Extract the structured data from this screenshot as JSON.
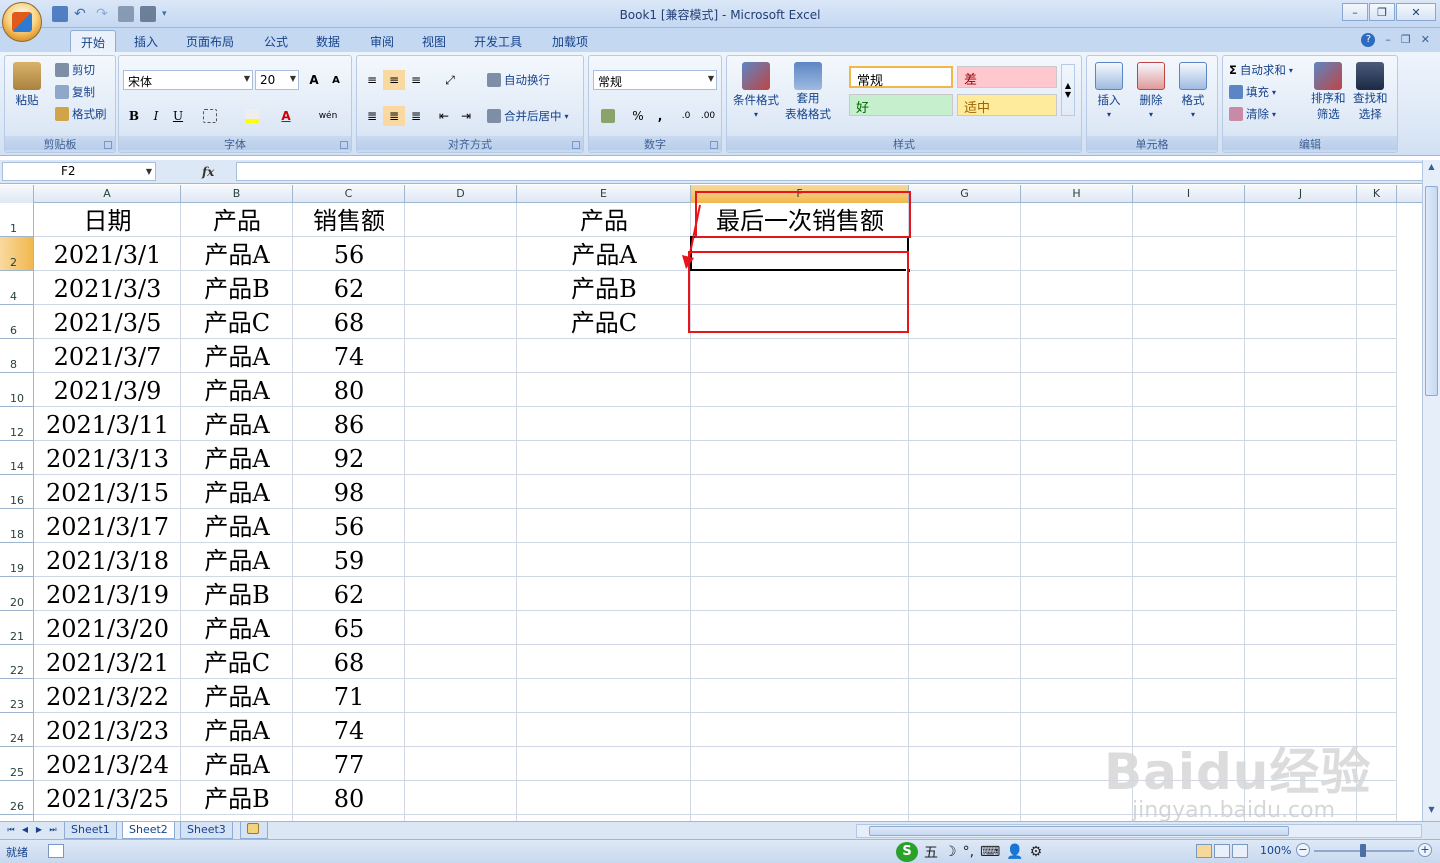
{
  "window": {
    "title": "Book1  [兼容模式] - Microsoft Excel",
    "minimize": "–",
    "restore": "❐",
    "close": "✕"
  },
  "tabs": [
    "开始",
    "插入",
    "页面布局",
    "公式",
    "数据",
    "审阅",
    "视图",
    "开发工具",
    "加载项"
  ],
  "ribbon": {
    "clipboard": {
      "paste": "粘贴",
      "cut": "剪切",
      "copy": "复制",
      "format_painter": "格式刷",
      "label": "剪贴板"
    },
    "font": {
      "name": "宋体",
      "size": "20",
      "bold": "B",
      "italic": "I",
      "underline": "U",
      "label": "字体",
      "grow": "A",
      "shrink": "A",
      "font_color": "A",
      "phonetic": "wén"
    },
    "alignment": {
      "wrap": "自动换行",
      "merge": "合并后居中",
      "label": "对齐方式"
    },
    "number": {
      "format": "常规",
      "percent": "%",
      "comma": ",",
      "label": "数字"
    },
    "styles": {
      "conditional": "条件格式",
      "table": "套用",
      "table2": "表格格式",
      "normal": "常规",
      "bad": "差",
      "good": "好",
      "neutral": "适中",
      "label": "样式"
    },
    "cells": {
      "insert": "插入",
      "delete": "删除",
      "format": "格式",
      "label": "单元格"
    },
    "editing": {
      "autosum": "自动求和",
      "fill": "填充",
      "clear": "清除",
      "sort1": "排序和",
      "sort2": "筛选",
      "find1": "查找和",
      "find2": "选择",
      "label": "编辑"
    },
    "colors": {
      "bad_bg": "#ffc7ce",
      "bad_fg": "#9c0006",
      "good_bg": "#c6efce",
      "good_fg": "#006100",
      "neutral_bg": "#ffeb9c",
      "neutral_fg": "#9c6500"
    }
  },
  "formula_bar": {
    "name_box": "F2",
    "fx": "fx",
    "value": ""
  },
  "columns": [
    "A",
    "B",
    "C",
    "D",
    "E",
    "F",
    "G",
    "H",
    "I",
    "J",
    "K"
  ],
  "selected_column": "F",
  "rows": [
    {
      "num": "1",
      "a": "日期",
      "b": "产品",
      "c": "销售额",
      "e": "产品",
      "f": "最后一次销售额"
    },
    {
      "num": "2",
      "a": "2021/3/1",
      "b": "产品A",
      "c": "56",
      "e": "产品A",
      "f": ""
    },
    {
      "num": "4",
      "a": "2021/3/3",
      "b": "产品B",
      "c": "62",
      "e": "产品B",
      "f": ""
    },
    {
      "num": "6",
      "a": "2021/3/5",
      "b": "产品C",
      "c": "68",
      "e": "产品C",
      "f": ""
    },
    {
      "num": "8",
      "a": "2021/3/7",
      "b": "产品A",
      "c": "74",
      "e": "",
      "f": ""
    },
    {
      "num": "10",
      "a": "2021/3/9",
      "b": "产品A",
      "c": "80",
      "e": "",
      "f": ""
    },
    {
      "num": "12",
      "a": "2021/3/11",
      "b": "产品A",
      "c": "86",
      "e": "",
      "f": ""
    },
    {
      "num": "14",
      "a": "2021/3/13",
      "b": "产品A",
      "c": "92",
      "e": "",
      "f": ""
    },
    {
      "num": "16",
      "a": "2021/3/15",
      "b": "产品A",
      "c": "98",
      "e": "",
      "f": ""
    },
    {
      "num": "18",
      "a": "2021/3/17",
      "b": "产品A",
      "c": "56",
      "e": "",
      "f": ""
    },
    {
      "num": "19",
      "a": "2021/3/18",
      "b": "产品A",
      "c": "59",
      "e": "",
      "f": ""
    },
    {
      "num": "20",
      "a": "2021/3/19",
      "b": "产品B",
      "c": "62",
      "e": "",
      "f": ""
    },
    {
      "num": "21",
      "a": "2021/3/20",
      "b": "产品A",
      "c": "65",
      "e": "",
      "f": ""
    },
    {
      "num": "22",
      "a": "2021/3/21",
      "b": "产品C",
      "c": "68",
      "e": "",
      "f": ""
    },
    {
      "num": "23",
      "a": "2021/3/22",
      "b": "产品A",
      "c": "71",
      "e": "",
      "f": ""
    },
    {
      "num": "24",
      "a": "2021/3/23",
      "b": "产品A",
      "c": "74",
      "e": "",
      "f": ""
    },
    {
      "num": "25",
      "a": "2021/3/24",
      "b": "产品A",
      "c": "77",
      "e": "",
      "f": ""
    },
    {
      "num": "26",
      "a": "2021/3/25",
      "b": "产品B",
      "c": "80",
      "e": "",
      "f": ""
    }
  ],
  "sheets": [
    "Sheet1",
    "Sheet2",
    "Sheet3"
  ],
  "active_sheet": "Sheet2",
  "status": {
    "ready": "就绪",
    "zoom": "100%",
    "ime": "五"
  },
  "annotation_color": "#e8141b",
  "watermark": {
    "text": "Baidu经验",
    "url": "jingyan.baidu.com"
  }
}
